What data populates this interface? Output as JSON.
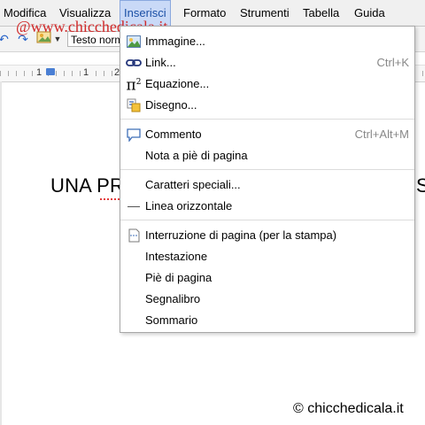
{
  "menubar": {
    "items": [
      {
        "label": "Modifica"
      },
      {
        "label": "Visualizza"
      },
      {
        "label": "Inserisci"
      },
      {
        "label": "Formato"
      },
      {
        "label": "Strumenti"
      },
      {
        "label": "Tabella"
      },
      {
        "label": "Guida"
      }
    ],
    "active": "Inserisci",
    "active_bg": "#c9d9f7",
    "active_text": "#1a4fa5"
  },
  "toolbar": {
    "style_value": "Testo norm",
    "icons": [
      "undo-icon",
      "redo-icon",
      "image-icon"
    ]
  },
  "watermark": {
    "text": "@www.chicchedicala.it",
    "color": "#d02a2a"
  },
  "ruler": {
    "numbers": [
      "1",
      "1",
      "2"
    ]
  },
  "document": {
    "heading_left": "UNA PR",
    "heading_right": "S"
  },
  "insert_menu": {
    "groups": [
      [
        {
          "label": "Immagine...",
          "icon": "image-icon"
        },
        {
          "label": "Link...",
          "icon": "link-icon",
          "shortcut": "Ctrl+K"
        },
        {
          "label": "Equazione...",
          "icon": "pi-squared-icon"
        },
        {
          "label": "Disegno...",
          "icon": "drawing-icon"
        }
      ],
      [
        {
          "label": "Commento",
          "icon": "comment-icon",
          "shortcut": "Ctrl+Alt+M"
        },
        {
          "label": "Nota a piè di pagina"
        }
      ],
      [
        {
          "label": "Caratteri speciali..."
        },
        {
          "label": "Linea orizzontale",
          "icon": "horizontal-line-icon"
        }
      ],
      [
        {
          "label": "Interruzione di pagina (per la stampa)",
          "icon": "page-break-icon"
        },
        {
          "label": "Intestazione"
        },
        {
          "label": "Piè di pagina"
        },
        {
          "label": "Segnalibro"
        },
        {
          "label": "Sommario"
        }
      ]
    ]
  },
  "footer": {
    "copyright": "© chicchedicala.it"
  }
}
